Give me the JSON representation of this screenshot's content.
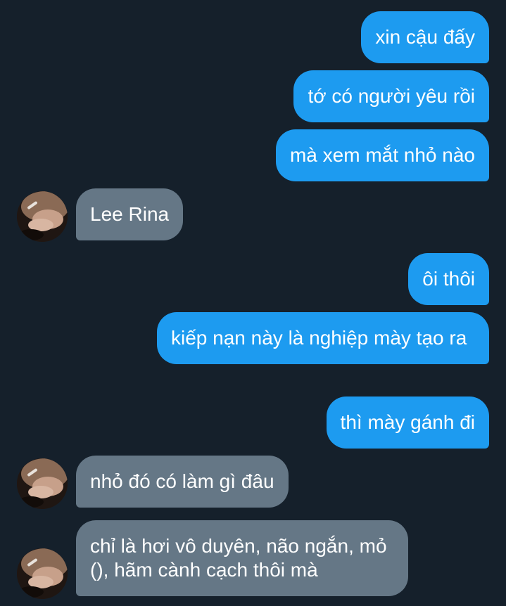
{
  "messages": [
    {
      "from": "me",
      "text": "xin cậu đấy"
    },
    {
      "from": "me",
      "text": "tớ có người yêu rồi"
    },
    {
      "from": "me",
      "text": "mà xem mắt nhỏ nào"
    },
    {
      "from": "other",
      "text": "Lee Rina"
    },
    {
      "from": "me",
      "text": "ôi thôi"
    },
    {
      "from": "me",
      "text": "kiếp nạn này là nghiệp mày tạo ra"
    },
    {
      "from": "me",
      "text": "thì mày gánh đi"
    },
    {
      "from": "other",
      "text": "nhỏ đó có làm gì đâu"
    },
    {
      "from": "other",
      "text": "chỉ là hơi vô duyên, não ngắn, mỏ (), hãm cành cạch thôi mà"
    }
  ],
  "colors": {
    "background": "#15202b",
    "outgoing_bubble": "#1d9bf0",
    "incoming_bubble": "#657786",
    "text": "#ffffff"
  },
  "contact": {
    "avatar_icon": "profile-photo-hand-avatar"
  }
}
